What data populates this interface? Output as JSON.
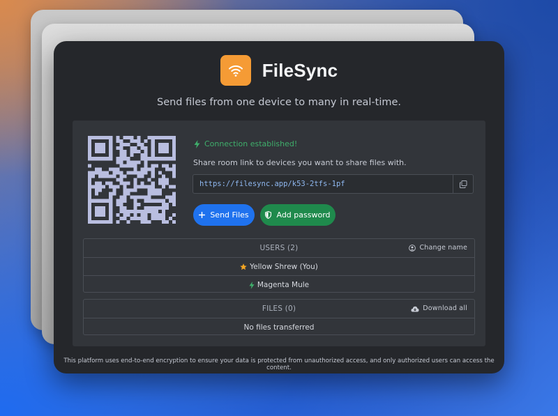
{
  "brand": {
    "name": "FileSync",
    "logo_icon": "wifi-icon",
    "accent": "#f59b35"
  },
  "tagline": "Send files from one device to many in real-time.",
  "room": {
    "status": "Connection established!",
    "status_color": "#3fae6b",
    "instructions": "Share room link to devices you want to share files with.",
    "link": "https://filesync.app/k53-2tfs-1pf",
    "copy_icon": "copy-icon"
  },
  "actions": {
    "send_files": "Send Files",
    "add_password": "Add password",
    "send_color": "#1f72ee",
    "password_color": "#1f8a4c"
  },
  "users": {
    "header": "USERS (2)",
    "change_name": "Change name",
    "items": [
      {
        "label": "Yellow Shrew (You)",
        "icon": "star-icon"
      },
      {
        "label": "Magenta Mule",
        "icon": "bolt-icon"
      }
    ]
  },
  "files": {
    "header": "FILES (0)",
    "download_all": "Download all",
    "empty": "No files transferred"
  },
  "footer": "This platform uses end-to-end encryption to ensure your data is protected from unauthorized access, and only authorized users can access the content."
}
